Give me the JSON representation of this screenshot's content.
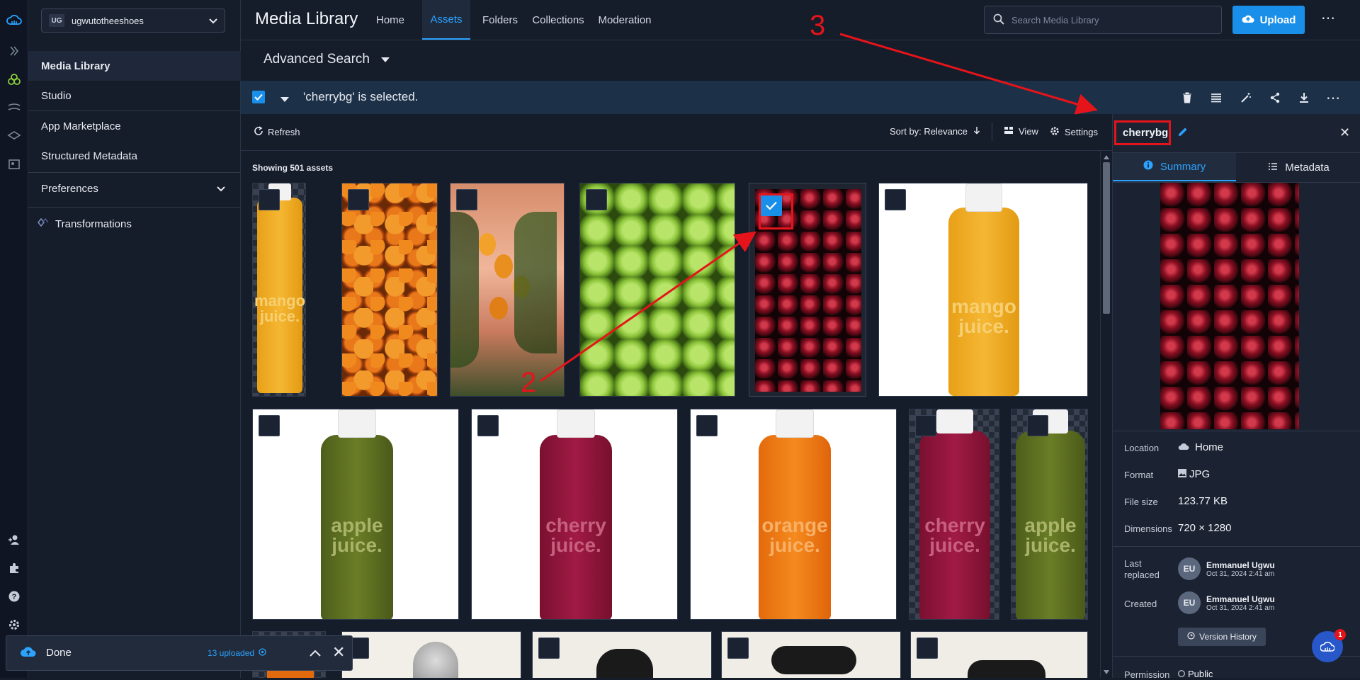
{
  "cloud_selector": {
    "initials": "UG",
    "name": "ugwutotheeshoes"
  },
  "sidebar": {
    "items": [
      {
        "label": "Media Library"
      },
      {
        "label": "Studio"
      },
      {
        "label": "App Marketplace"
      },
      {
        "label": "Structured Metadata"
      },
      {
        "label": "Preferences"
      },
      {
        "label": "Transformations"
      }
    ]
  },
  "header": {
    "title": "Media Library",
    "tabs": [
      "Home",
      "Assets",
      "Folders",
      "Collections",
      "Moderation"
    ],
    "active_tab": "Assets",
    "search_placeholder": "Search Media Library",
    "upload_label": "Upload"
  },
  "advanced_search": {
    "label": "Advanced Search"
  },
  "selection": {
    "text": "'cherrybg' is selected."
  },
  "toolbar": {
    "refresh": "Refresh",
    "sort": "Sort by: Relevance",
    "view": "View",
    "settings": "Settings",
    "showing": "Showing 501 assets"
  },
  "grid": {
    "row1": [
      {
        "label": "mango juice.",
        "theme": "mango-bottle-checker"
      },
      {
        "label": "",
        "theme": "oranges"
      },
      {
        "label": "",
        "theme": "mango-tree"
      },
      {
        "label": "",
        "theme": "green-apples"
      },
      {
        "label": "",
        "theme": "cherries",
        "selected": true
      },
      {
        "label": "mango juice.",
        "theme": "mango-bottle-white"
      }
    ],
    "row2": [
      {
        "label": "apple juice.",
        "theme": "apple-bottle-white"
      },
      {
        "label": "cherry juice.",
        "theme": "cherry-bottle-white"
      },
      {
        "label": "orange juice.",
        "theme": "orange-bottle-white"
      },
      {
        "label": "cherry juice.",
        "theme": "cherry-bottle-checker"
      },
      {
        "label": "apple juice.",
        "theme": "apple-bottle-checker"
      }
    ]
  },
  "panel": {
    "asset_name": "cherrybg",
    "tabs": [
      "Summary",
      "Metadata"
    ],
    "active_tab": "Summary",
    "location_label": "Location",
    "location": "Home",
    "format_label": "Format",
    "format": "JPG",
    "filesize_label": "File size",
    "filesize": "123.77 KB",
    "dimensions_label": "Dimensions",
    "dimensions": "720 × 1280",
    "last_replaced_label_1": "Last",
    "last_replaced_label_2": "replaced",
    "created_label": "Created",
    "user_initials": "EU",
    "user_name": "Emmanuel Ugwu",
    "date": "Oct 31, 2024 2:41 am",
    "version_history": "Version History",
    "permission_label": "Permission",
    "permission": "Public"
  },
  "toast": {
    "status": "Done",
    "uploaded": "13 uploaded"
  },
  "chat_badge": "1",
  "annotations": {
    "a2": "2",
    "a3": "3"
  },
  "colors": {
    "accent": "#1a8fea",
    "annotation": "#e5141a",
    "selection_bar": "#1c3148"
  }
}
